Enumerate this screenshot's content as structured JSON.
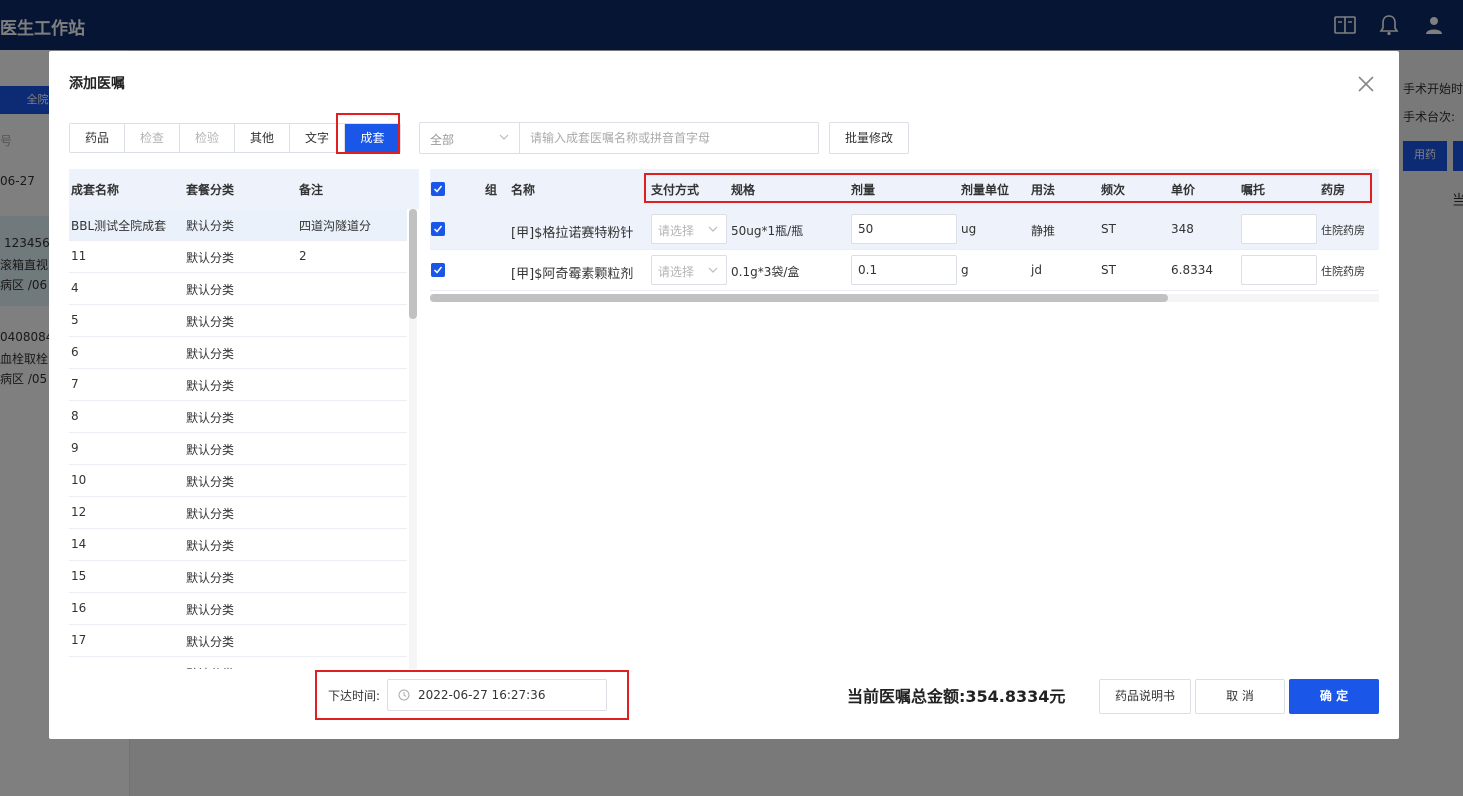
{
  "app": {
    "title": "医生工作站",
    "bg_left_button": "全院",
    "bg_left_hint": "号",
    "bg_date": "06-27",
    "bg_patient_1": "123456",
    "bg_patient_2": "滚箱直视",
    "bg_patient_3": "病区 /06",
    "bg_patient_4": "0408084",
    "bg_patient_5": "血栓取栓",
    "bg_patient_6": "病区 /05",
    "bg_right_text_1": "手术开始时",
    "bg_right_text_2": "手术台次:",
    "bg_right_button": "用药",
    "bg_right_label": "当"
  },
  "dialog": {
    "title": "添加医嘱",
    "tabs": [
      {
        "label": "药品",
        "state": "normal"
      },
      {
        "label": "检查",
        "state": "disabled"
      },
      {
        "label": "检验",
        "state": "disabled"
      },
      {
        "label": "其他",
        "state": "normal"
      },
      {
        "label": "文字",
        "state": "normal"
      },
      {
        "label": "成套",
        "state": "active"
      }
    ],
    "filter_select": "全部",
    "search_placeholder": "请输入成套医嘱名称或拼音首字母",
    "batch_button": "批量修改",
    "set_table": {
      "headers": [
        "成套名称",
        "套餐分类",
        "备注"
      ],
      "rows": [
        {
          "name": "BBL测试全院成套",
          "category": "默认分类",
          "note": "四道沟隧道分"
        },
        {
          "name": "11",
          "category": "默认分类",
          "note": "2"
        },
        {
          "name": "4",
          "category": "默认分类",
          "note": ""
        },
        {
          "name": "5",
          "category": "默认分类",
          "note": ""
        },
        {
          "name": "6",
          "category": "默认分类",
          "note": ""
        },
        {
          "name": "7",
          "category": "默认分类",
          "note": ""
        },
        {
          "name": "8",
          "category": "默认分类",
          "note": ""
        },
        {
          "name": "9",
          "category": "默认分类",
          "note": ""
        },
        {
          "name": "10",
          "category": "默认分类",
          "note": ""
        },
        {
          "name": "12",
          "category": "默认分类",
          "note": ""
        },
        {
          "name": "14",
          "category": "默认分类",
          "note": ""
        },
        {
          "name": "15",
          "category": "默认分类",
          "note": ""
        },
        {
          "name": "16",
          "category": "默认分类",
          "note": ""
        },
        {
          "name": "17",
          "category": "默认分类",
          "note": ""
        },
        {
          "name": "",
          "category": "默认分类",
          "note": ""
        }
      ]
    },
    "order_table": {
      "headers": {
        "group": "组",
        "name": "名称",
        "pay": "支付方式",
        "spec": "规格",
        "dose": "剂量",
        "unit": "剂量单位",
        "usage": "用法",
        "freq": "频次",
        "price": "单价",
        "note": "嘱托",
        "pharmacy": "药房"
      },
      "pay_placeholder": "请选择",
      "rows": [
        {
          "name": "[甲]$格拉诺赛特粉针",
          "spec": "50ug*1瓶/瓶",
          "dose": "50",
          "unit": "ug",
          "usage": "静推",
          "freq": "ST",
          "price": "348",
          "note": "",
          "pharmacy": "住院药房"
        },
        {
          "name": "[甲]$阿奇霉素颗粒剂",
          "spec": "0.1g*3袋/盒",
          "dose": "0.1",
          "unit": "g",
          "usage": "jd",
          "freq": "ST",
          "price": "6.8334",
          "note": "",
          "pharmacy": "住院药房"
        }
      ]
    },
    "time_label": "下达时间:",
    "time_value": "2022-06-27 16:27:36",
    "total_label": "当前医嘱总金额:354.8334元",
    "buttons": {
      "manual": "药品说明书",
      "cancel": "取 消",
      "confirm": "确 定"
    }
  },
  "colors": {
    "primary": "#1a56e8",
    "header": "#0e2a6b",
    "highlight": "#e02020"
  }
}
